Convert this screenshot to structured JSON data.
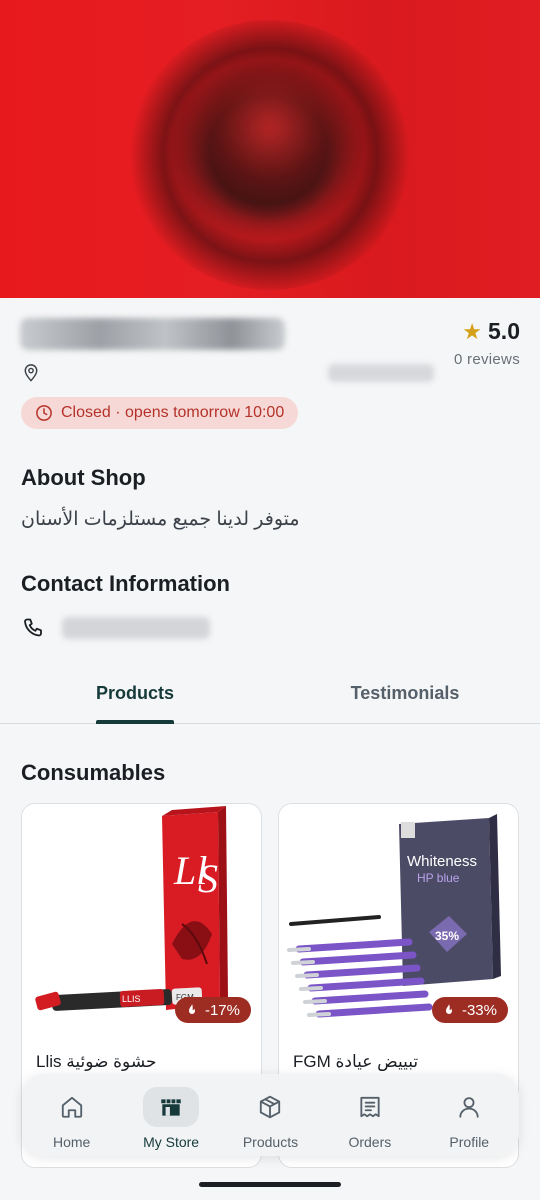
{
  "shop": {
    "rating": "5.0",
    "reviews": "0 reviews",
    "status": "Closed · opens tomorrow 10:00"
  },
  "about": {
    "title": "About Shop",
    "text": "متوفر لدينا جميع مستلزمات الأسنان"
  },
  "contact": {
    "title": "Contact Information"
  },
  "tabs": [
    {
      "label": "Products",
      "active": true
    },
    {
      "label": "Testimonials",
      "active": false
    }
  ],
  "category": {
    "title": "Consumables",
    "products": [
      {
        "name": "حشوة ضوئية Llis",
        "discount": "-17%"
      },
      {
        "name": "تبييض عيادة FGM",
        "discount": "-33%"
      }
    ]
  },
  "nav": [
    {
      "label": "Home",
      "icon": "home-icon"
    },
    {
      "label": "My Store",
      "icon": "store-icon",
      "active": true
    },
    {
      "label": "Products",
      "icon": "box-icon"
    },
    {
      "label": "Orders",
      "icon": "receipt-icon"
    },
    {
      "label": "Profile",
      "icon": "person-icon"
    }
  ],
  "colors": {
    "accent": "#163a3a",
    "status_bg": "#f6d9d6",
    "status_text": "#b4322a",
    "badge": "#9d2c22",
    "star": "#d4a017"
  }
}
